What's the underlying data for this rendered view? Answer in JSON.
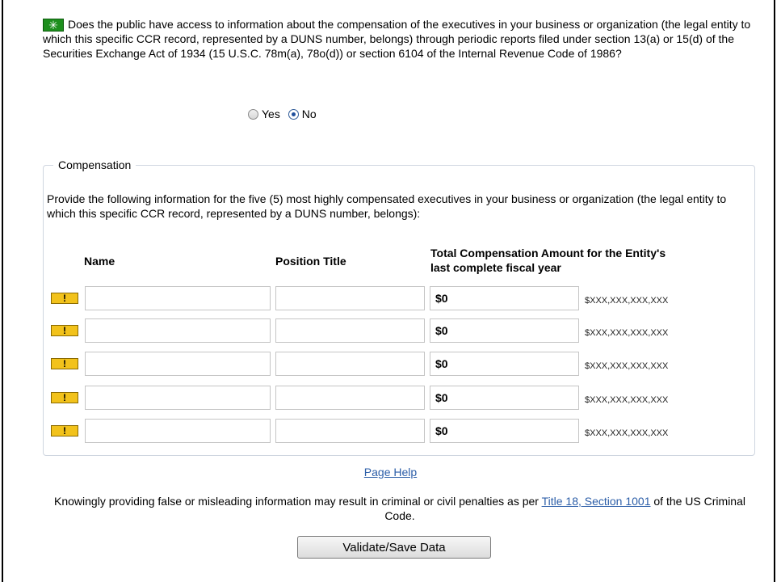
{
  "question": {
    "asterisk": "✳",
    "text": "Does the public have access to information about the compensation of the executives in your business or organization (the legal entity to which this specific CCR record, represented by a DUNS number, belongs) through periodic reports filed under section 13(a) or 15(d) of the Securities Exchange Act of 1934 (15 U.S.C. 78m(a), 78o(d)) or section 6104 of the Internal Revenue Code of 1986?"
  },
  "radios": [
    {
      "label": "Yes",
      "checked": false
    },
    {
      "label": "No",
      "checked": true
    }
  ],
  "compensation": {
    "legend": "Compensation",
    "instructions": "Provide the following information for the five (5) most highly compensated executives in your business or organization (the legal entity to which this specific CCR record, represented by a DUNS number, belongs):",
    "columns": {
      "name": "Name",
      "position": "Position Title",
      "amount_line1": "Total Compensation Amount for the Entity's",
      "amount_line2": "last complete fiscal year"
    },
    "warning_icon": "!",
    "rows": [
      {
        "name": "",
        "position": "",
        "amount": "$0",
        "format": "$XXX,XXX,XXX,XXX"
      },
      {
        "name": "",
        "position": "",
        "amount": "$0",
        "format": "$XXX,XXX,XXX,XXX"
      },
      {
        "name": "",
        "position": "",
        "amount": "$0",
        "format": "$XXX,XXX,XXX,XXX"
      },
      {
        "name": "",
        "position": "",
        "amount": "$0",
        "format": "$XXX,XXX,XXX,XXX"
      },
      {
        "name": "",
        "position": "",
        "amount": "$0",
        "format": "$XXX,XXX,XXX,XXX"
      }
    ]
  },
  "page_help": "Page Help",
  "penalty": {
    "before": "Knowingly providing false or misleading information may result in criminal or civil penalties as per ",
    "link": "Title 18, Section 1001",
    "after": " of the US Criminal Code."
  },
  "button": "Validate/Save Data",
  "colors": {
    "asterisk_bg": "#1d8f1d",
    "warning_bg": "#f2c21b",
    "link": "#2c5ea8"
  }
}
